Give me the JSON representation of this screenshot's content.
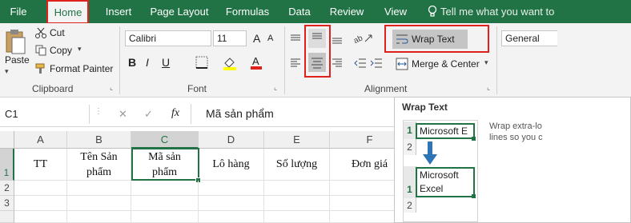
{
  "tabs": [
    "File",
    "Home",
    "Insert",
    "Page Layout",
    "Formulas",
    "Data",
    "Review",
    "View"
  ],
  "tell_me": "Tell me what you want to",
  "clipboard": {
    "paste": "Paste",
    "cut": "Cut",
    "copy": "Copy",
    "format_painter": "Format Painter",
    "label": "Clipboard"
  },
  "font": {
    "name": "Calibri",
    "size": "11",
    "bold": "B",
    "italic": "I",
    "underline": "U",
    "grow": "A",
    "shrink": "A",
    "label": "Font"
  },
  "alignment": {
    "wrap_text": "Wrap Text",
    "merge_center": "Merge & Center",
    "label": "Alignment"
  },
  "number": {
    "format": "General"
  },
  "formula_bar": {
    "name_box": "C1",
    "cancel": "✕",
    "enter": "✓",
    "fx": "fx",
    "content": "Mã sản phẩm"
  },
  "columns": [
    "A",
    "B",
    "C",
    "D",
    "E",
    "F"
  ],
  "rows": [
    "1",
    "2",
    "3"
  ],
  "cells": {
    "A1": "TT",
    "B1_line1": "Tên Sản",
    "B1_line2": "phẩm",
    "C1_line1": "Mã sản",
    "C1_line2": "phẩm",
    "D1": "Lô hàng",
    "E1": "Số lượng",
    "F1": "Đơn giá"
  },
  "tooltip": {
    "title": "Wrap Text",
    "before_row1": "1",
    "before_row2": "2",
    "before_cell": "Microsoft E",
    "after_row1": "1",
    "after_row2": "2",
    "after_line1": "Microsoft",
    "after_line2": "Excel",
    "desc_line1": "Wrap extra-lo",
    "desc_line2": "lines so you c"
  },
  "colors": {
    "excel_green": "#217346",
    "highlight_red": "#e0201b",
    "selected_button": "#c5c5c5"
  }
}
